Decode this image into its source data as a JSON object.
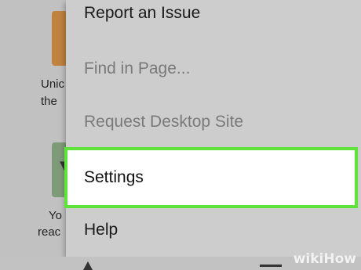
{
  "background": {
    "texts": [
      "Unic",
      "the",
      "Yo",
      "reac"
    ],
    "tile_glyph": "▼"
  },
  "menu": {
    "items": [
      {
        "label": "Report an Issue",
        "enabled": true
      },
      {
        "label": "Find in Page...",
        "enabled": false
      },
      {
        "label": "Request Desktop Site",
        "enabled": false
      },
      {
        "label": "Settings",
        "enabled": true,
        "highlighted": true
      },
      {
        "label": "Help",
        "enabled": true
      }
    ]
  },
  "watermark": {
    "prefix": "wiki",
    "suffix": "How"
  },
  "colors": {
    "highlight_border": "#5fe33b",
    "menu_bg": "#cdcdcd",
    "tile_orange": "#c0823f",
    "tile_green": "#7e9a79"
  }
}
